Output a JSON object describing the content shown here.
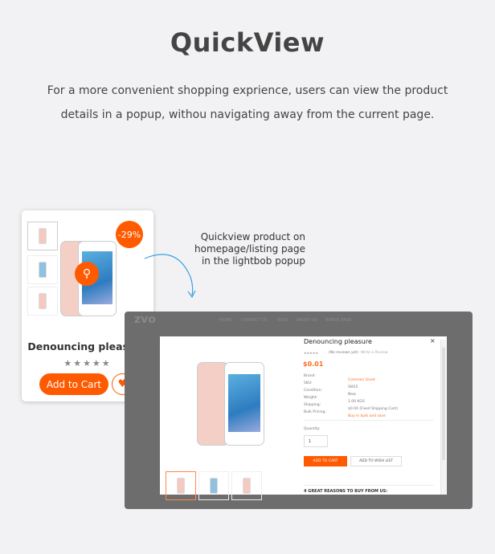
{
  "header": {
    "title": "QuickView",
    "description_line1": "For a more convenient shopping exprience, users can view the product",
    "description_line2": "details in a popup, withou navigating away from the current page."
  },
  "card": {
    "badge": "-29%",
    "product_name": "Denouncing pleasure",
    "stars": "★★★★★",
    "add_to_cart": "Add to Cart",
    "icons": [
      "search-icon",
      "heart-icon"
    ]
  },
  "annotation": {
    "line1": "Quickview product on",
    "line2": "homepage/listing page",
    "line3": "in the lightbob popup"
  },
  "background_site": {
    "logo": "zvo",
    "nav": [
      "HOME",
      "CONTACT US",
      "BLOG",
      "ABOUT US",
      "BONUS PAGE"
    ]
  },
  "popup": {
    "title": "Denouncing pleasure",
    "stars": "★★★★★",
    "reviews": "(No reviews yet)",
    "write_review": "Write a Review",
    "price": "$0.01",
    "details": [
      {
        "label": "Brand:",
        "value": "Common Good",
        "highlight": true
      },
      {
        "label": "SKU:",
        "value": "SM15",
        "highlight": false
      },
      {
        "label": "Condition:",
        "value": "New",
        "highlight": false
      },
      {
        "label": "Weight:",
        "value": "1.00 KGS",
        "highlight": false
      },
      {
        "label": "Shipping:",
        "value": "$0.00 (Fixed Shipping Cost)",
        "highlight": false
      },
      {
        "label": "Bulk Pricing:",
        "value": "Buy in bulk and save",
        "highlight": true
      }
    ],
    "quantity_label": "Quantity:",
    "quantity": "1",
    "add_to_cart": "ADD TO CART",
    "add_to_wishlist": "ADD TO WISH LIST",
    "reasons_heading": "4 GREAT REASONS TO BUY FROM US:",
    "close": "×"
  },
  "colors": {
    "accent": "#ff5a00",
    "background": "#f2f2f4",
    "arrow": "#3aa0e8"
  }
}
